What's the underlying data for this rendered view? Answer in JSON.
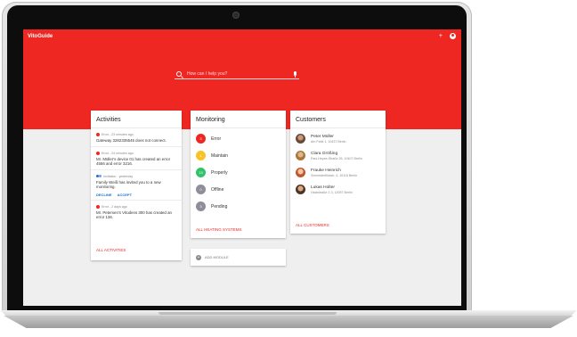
{
  "app": {
    "title": "VitoGuide",
    "search_placeholder": "How can I help you?",
    "accent_color": "#ee2722"
  },
  "activities": {
    "title": "Activities",
    "items": [
      {
        "type": "error",
        "meta": "Error - 23 minutes ago",
        "message": "Gateway 3282335545 does not connect."
      },
      {
        "type": "error",
        "meta": "Error - 24 minutes ago",
        "message": "Mr. Müller's device 01 has created an error 4556 and error 3216."
      },
      {
        "type": "invitation",
        "meta": "Invitation - yesterday",
        "message": "Family Weiß has invited you to a new monitoring.",
        "actions": [
          "DECLINE",
          "ACCEPT"
        ]
      },
      {
        "type": "error",
        "meta": "Error - 2 days ago",
        "message": "Mr. Petersen's Vitodens 300 has created an error 136."
      }
    ],
    "footer": "ALL ACTIVITIES"
  },
  "monitoring": {
    "title": "Monitoring",
    "rows": [
      {
        "count": "3",
        "label": "Error",
        "color": "#ee2722"
      },
      {
        "count": "1",
        "label": "Maintain",
        "color": "#f7c325"
      },
      {
        "count": "13",
        "label": "Properly",
        "color": "#2fc36a"
      },
      {
        "count": "0",
        "label": "Offline",
        "color": "#8e8e99"
      },
      {
        "count": "3",
        "label": "Pending",
        "color": "#8e8e99"
      }
    ],
    "footer": "ALL HEATING SYSTEMS"
  },
  "add_module": {
    "label": "ADD MODULE"
  },
  "customers": {
    "title": "Customers",
    "items": [
      {
        "name": "Peter Müller",
        "address": "Am Feldt 1, 10437 Berlin"
      },
      {
        "name": "Clara Größing",
        "address": "Paul-Heyse-Straße 26, 10407 Berlin"
      },
      {
        "name": "Frauke Heinrich",
        "address": "Schneiderflickstr. 4, 10115 Berlin"
      },
      {
        "name": "Lukas Holter",
        "address": "Hackstraße 2-3, 12057 Berlin"
      }
    ],
    "footer": "ALL CUSTOMERS"
  }
}
